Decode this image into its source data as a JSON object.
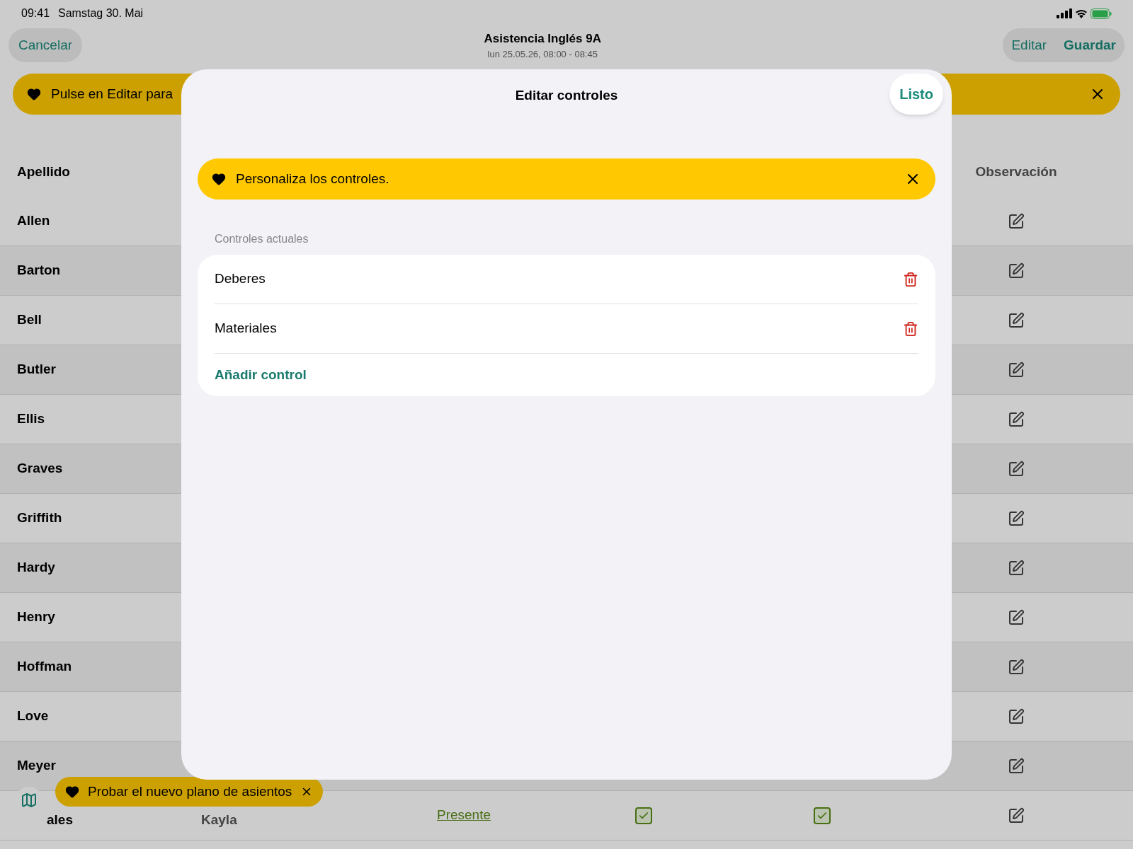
{
  "status_bar": {
    "time": "09:41",
    "date": "Samstag 30. Mai"
  },
  "nav": {
    "cancel": "Cancelar",
    "title": "Asistencia Inglés 9A",
    "subtitle": "lun 25.05.26, 08:00 - 08:45",
    "edit": "Editar",
    "save": "Guardar"
  },
  "banner": {
    "text": "Pulse en Editar para"
  },
  "table": {
    "columns": [
      "Apellido",
      "Observación"
    ],
    "rows": [
      {
        "last_name": "Allen"
      },
      {
        "last_name": "Barton"
      },
      {
        "last_name": "Bell"
      },
      {
        "last_name": "Butler"
      },
      {
        "last_name": "Ellis"
      },
      {
        "last_name": "Graves"
      },
      {
        "last_name": "Griffith"
      },
      {
        "last_name": "Hardy"
      },
      {
        "last_name": "Henry"
      },
      {
        "last_name": "Hoffman"
      },
      {
        "last_name": "Love"
      },
      {
        "last_name": "Meyer"
      },
      {
        "last_name": "ales",
        "clipped": true,
        "first_name": "Kayla",
        "status": "Presente",
        "check_1": true,
        "check_2": true
      }
    ]
  },
  "toast": {
    "text": "Probar el nuevo plano de asientos"
  },
  "modal": {
    "title": "Editar controles",
    "done": "Listo",
    "tip": "Personaliza los controles.",
    "section": "Controles actuales",
    "controls": [
      {
        "name": "Deberes"
      },
      {
        "name": "Materiales"
      }
    ],
    "add": "Añadir control"
  }
}
